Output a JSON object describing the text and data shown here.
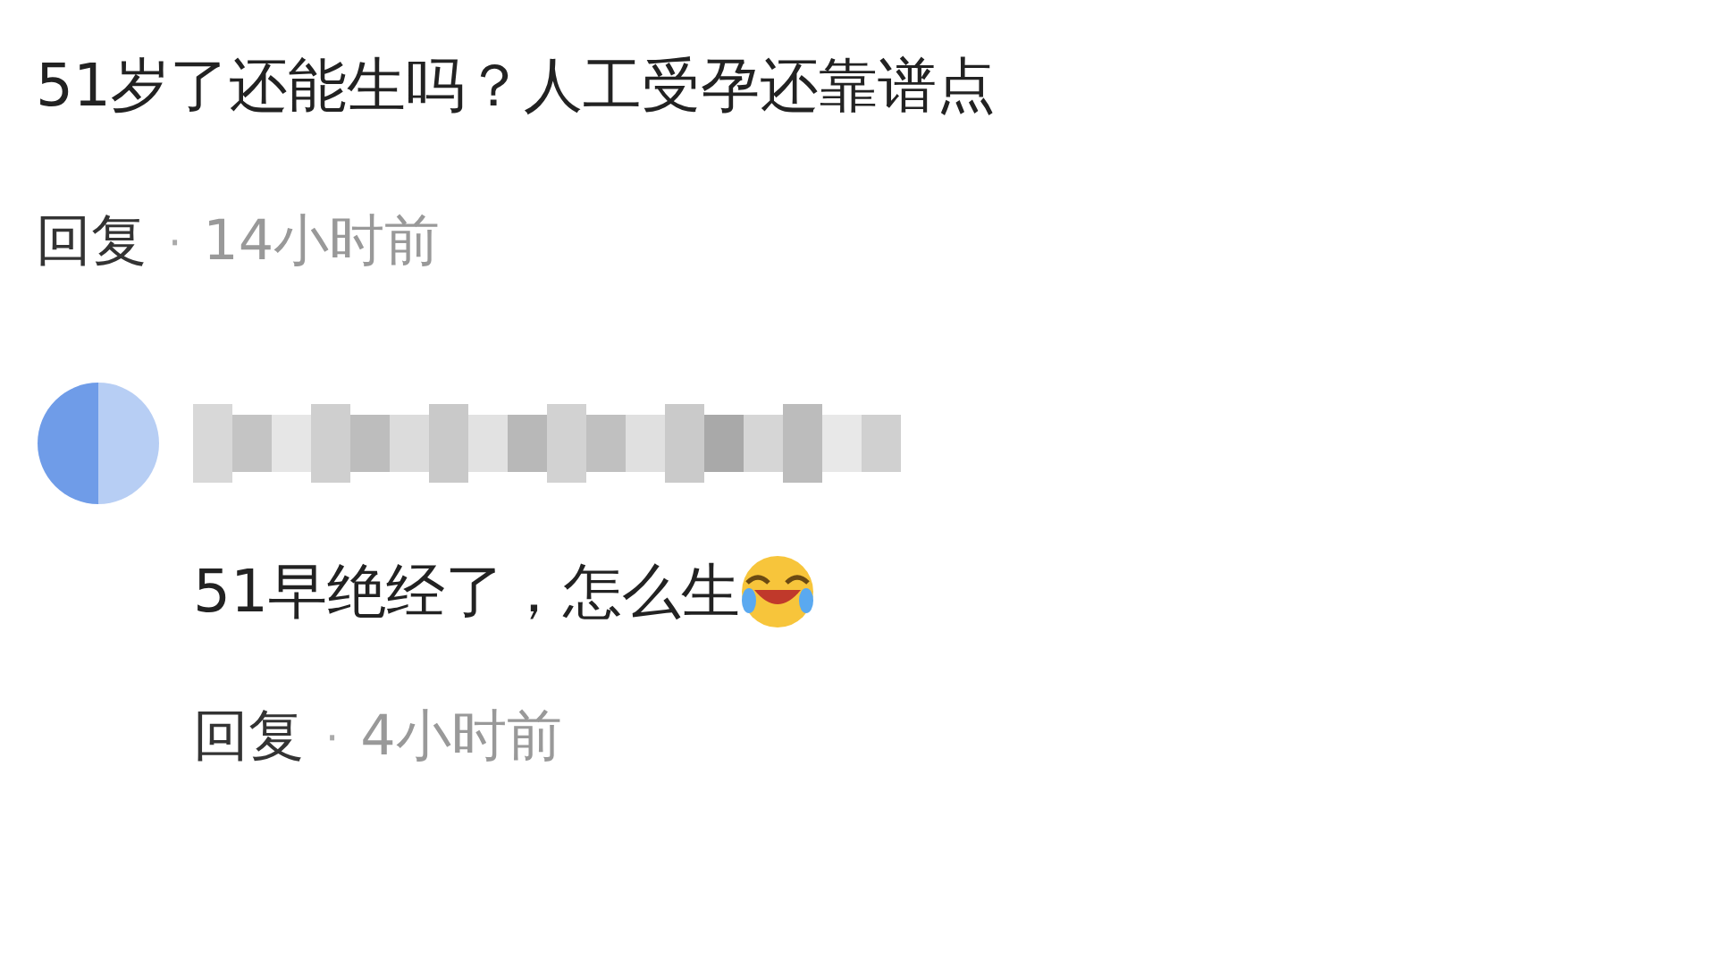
{
  "comment": {
    "text": "51岁了还能生吗？人工受孕还靠谱点",
    "reply_label": "回复",
    "separator": "·",
    "time": "14小时前"
  },
  "replies": [
    {
      "text": "51早绝经了，怎么生",
      "reply_label": "回复",
      "separator": "·",
      "time": "4小时前"
    }
  ]
}
